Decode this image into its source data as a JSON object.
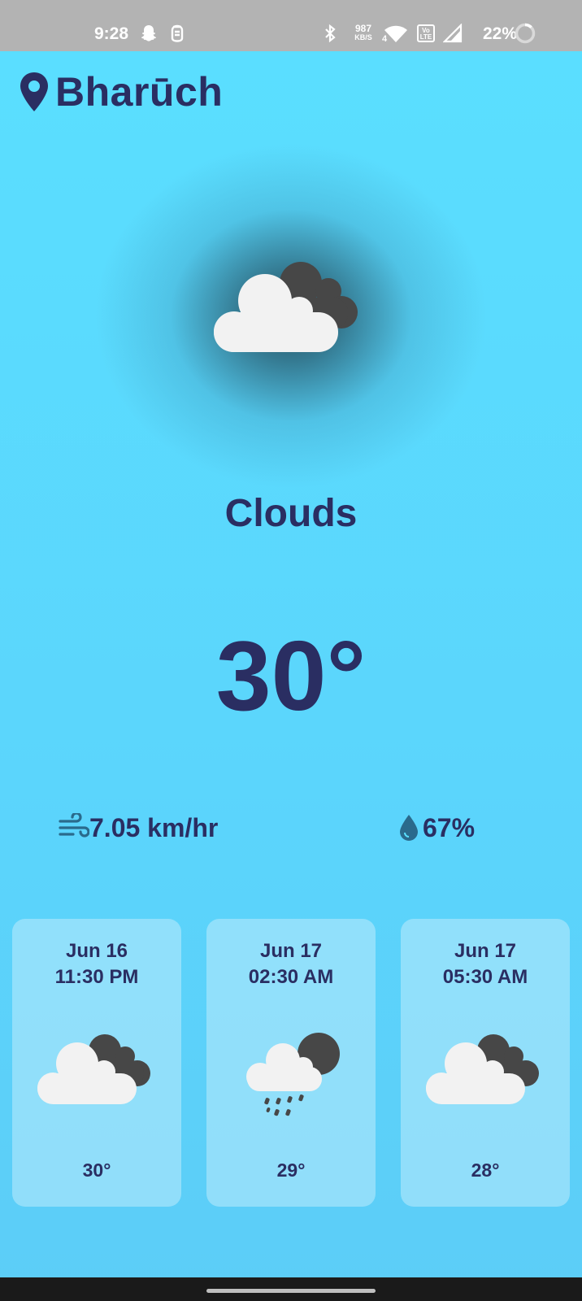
{
  "status_bar": {
    "time": "9:28",
    "speed_value": "987",
    "speed_unit": "KB/S",
    "network_gen": "4",
    "volte_top": "Vo",
    "volte_bottom": "LTE",
    "battery": "22%",
    "icons": [
      "snapchat-icon",
      "notification-app-icon",
      "bluetooth-icon",
      "wifi-icon",
      "volte-icon",
      "signal-icon",
      "battery-ring-icon"
    ]
  },
  "location": {
    "icon": "map-pin-icon",
    "city": "Bharūch"
  },
  "current": {
    "icon": "cloud-dark-cloud-icon",
    "condition": "Clouds",
    "temperature": "30°",
    "wind": {
      "icon": "wind-icon",
      "value": "7.05 km/hr"
    },
    "humidity": {
      "icon": "water-drop-icon",
      "value": "67%"
    }
  },
  "forecast": [
    {
      "date": "Jun 16",
      "time": "11:30 PM",
      "icon": "cloud-dark-cloud-icon",
      "temp": "30°"
    },
    {
      "date": "Jun 17",
      "time": "02:30 AM",
      "icon": "cloud-moon-rain-icon",
      "temp": "29°"
    },
    {
      "date": "Jun 17",
      "time": "05:30 AM",
      "icon": "cloud-dark-cloud-icon",
      "temp": "28°"
    }
  ],
  "colors": {
    "background": "#5ADFFF",
    "text": "#2A2E62",
    "cloud_light": "#F2F2F2",
    "cloud_dark": "#474747",
    "status_bar": "#B3B3B3",
    "nav_bar": "#1A1A1A"
  }
}
